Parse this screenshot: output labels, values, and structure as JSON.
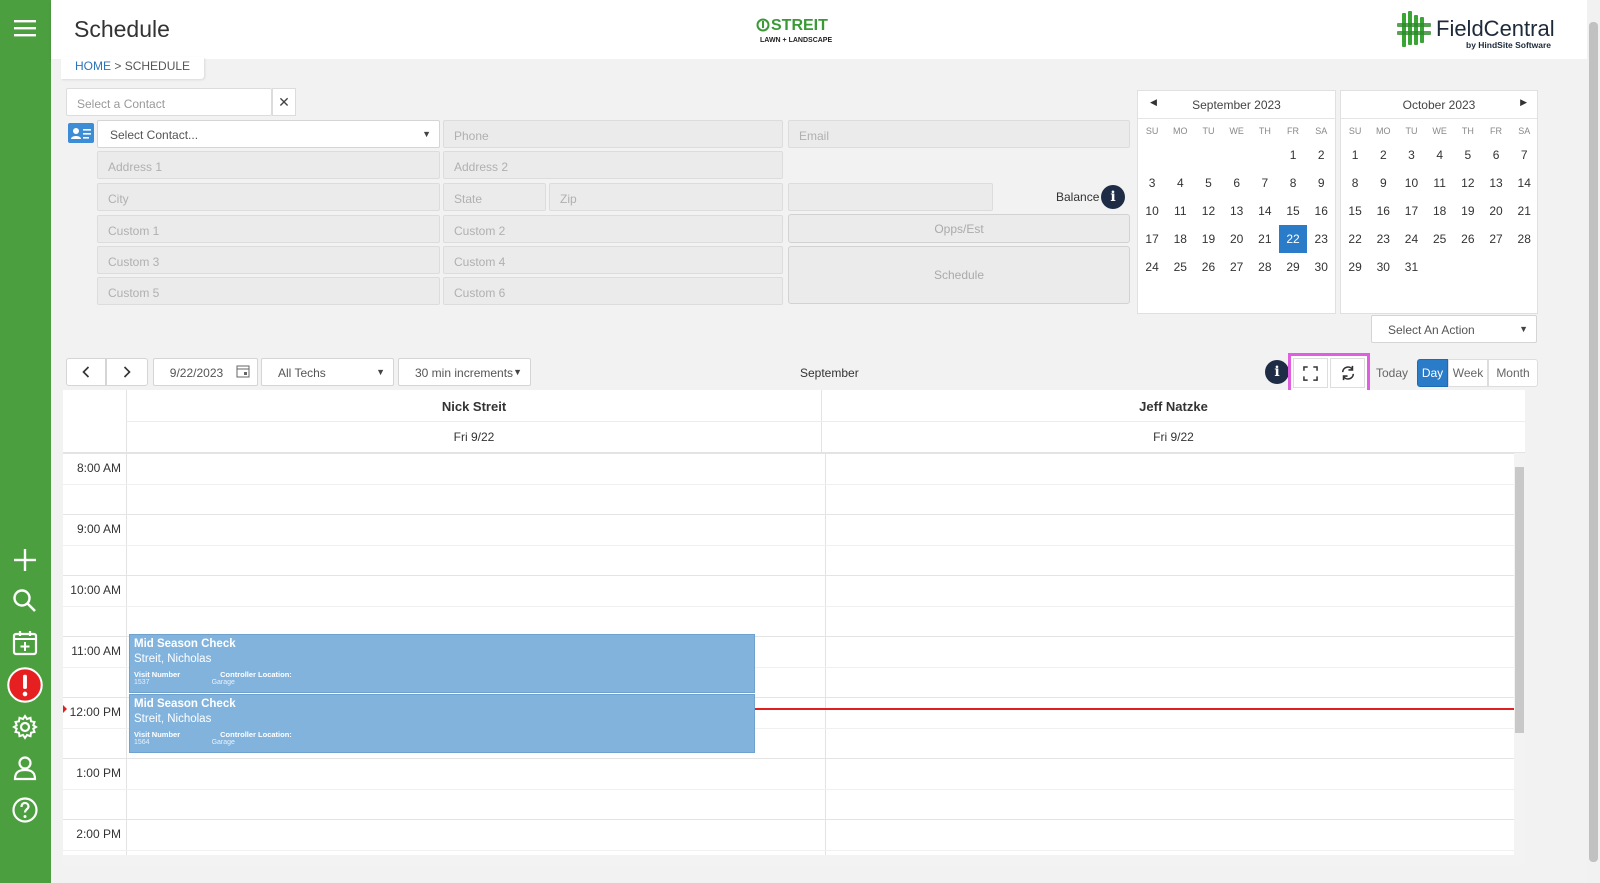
{
  "header": {
    "title": "Schedule",
    "brand_left": {
      "line1": "STREIT",
      "line2": "LAWN + LANDSCAPE"
    },
    "brand_right": {
      "name": "FieldCentral",
      "tagline": "by HindSite Software"
    }
  },
  "breadcrumb": {
    "home": "HOME",
    "separator": ">",
    "current": "SCHEDULE"
  },
  "sidebar": {
    "items": [
      "menu-icon",
      "add-icon",
      "search-icon",
      "calendar-add-icon",
      "alert-icon",
      "gear-icon",
      "user-icon",
      "help-icon"
    ]
  },
  "contact": {
    "search_placeholder": "Select a Contact",
    "select_label": "Select Contact...",
    "phone": "Phone",
    "email": "Email",
    "address1": "Address 1",
    "address2": "Address 2",
    "city": "City",
    "state": "State",
    "zip": "Zip",
    "custom1": "Custom 1",
    "custom2": "Custom 2",
    "custom3": "Custom 3",
    "custom4": "Custom 4",
    "custom5": "Custom 5",
    "custom6": "Custom 6",
    "balance_label": "Balance",
    "opps_label": "Opps/Est",
    "schedule_label": "Schedule"
  },
  "calendars": [
    {
      "title": "September 2023",
      "dow": [
        "SU",
        "MO",
        "TU",
        "WE",
        "TH",
        "FR",
        "SA"
      ],
      "days": [
        "",
        "",
        "",
        "",
        "",
        "1",
        "2",
        "3",
        "4",
        "5",
        "6",
        "7",
        "8",
        "9",
        "10",
        "11",
        "12",
        "13",
        "14",
        "15",
        "16",
        "17",
        "18",
        "19",
        "20",
        "21",
        "22",
        "23",
        "24",
        "25",
        "26",
        "27",
        "28",
        "29",
        "30"
      ],
      "selected": "22"
    },
    {
      "title": "October 2023",
      "dow": [
        "SU",
        "MO",
        "TU",
        "WE",
        "TH",
        "FR",
        "SA"
      ],
      "days": [
        "1",
        "2",
        "3",
        "4",
        "5",
        "6",
        "7",
        "8",
        "9",
        "10",
        "11",
        "12",
        "13",
        "14",
        "15",
        "16",
        "17",
        "18",
        "19",
        "20",
        "21",
        "22",
        "23",
        "24",
        "25",
        "26",
        "27",
        "28",
        "29",
        "30",
        "31"
      ],
      "selected": ""
    }
  ],
  "action_select": "Select An Action",
  "toolbar": {
    "date": "9/22/2023",
    "techs": "All Techs",
    "increments": "30 min increments",
    "month_label": "September",
    "today": "Today",
    "day": "Day",
    "week": "Week",
    "month": "Month",
    "active_view": "Day"
  },
  "schedule": {
    "techs": [
      {
        "name": "Nick Streit",
        "date": "Fri 9/22"
      },
      {
        "name": "Jeff Natzke",
        "date": "Fri 9/22"
      }
    ],
    "times": [
      "8:00 AM",
      "9:00 AM",
      "10:00 AM",
      "11:00 AM",
      "12:00 PM",
      "1:00 PM",
      "2:00 PM"
    ],
    "events": [
      {
        "title": "Mid Season Check",
        "customer": "Streit, Nicholas",
        "label1": "Visit Number",
        "label2": "Controller Location:",
        "value1": "1537",
        "value2": "Garage"
      },
      {
        "title": "Mid Season Check",
        "customer": "Streit, Nicholas",
        "label1": "Visit Number",
        "label2": "Controller Location:",
        "value1": "1564",
        "value2": "Garage"
      }
    ]
  },
  "colors": {
    "sidebar": "#4c9f3f",
    "accent": "#2a7bc8",
    "event": "#82b3dd",
    "highlight": "#e05ee0",
    "now_line": "#e02020"
  }
}
